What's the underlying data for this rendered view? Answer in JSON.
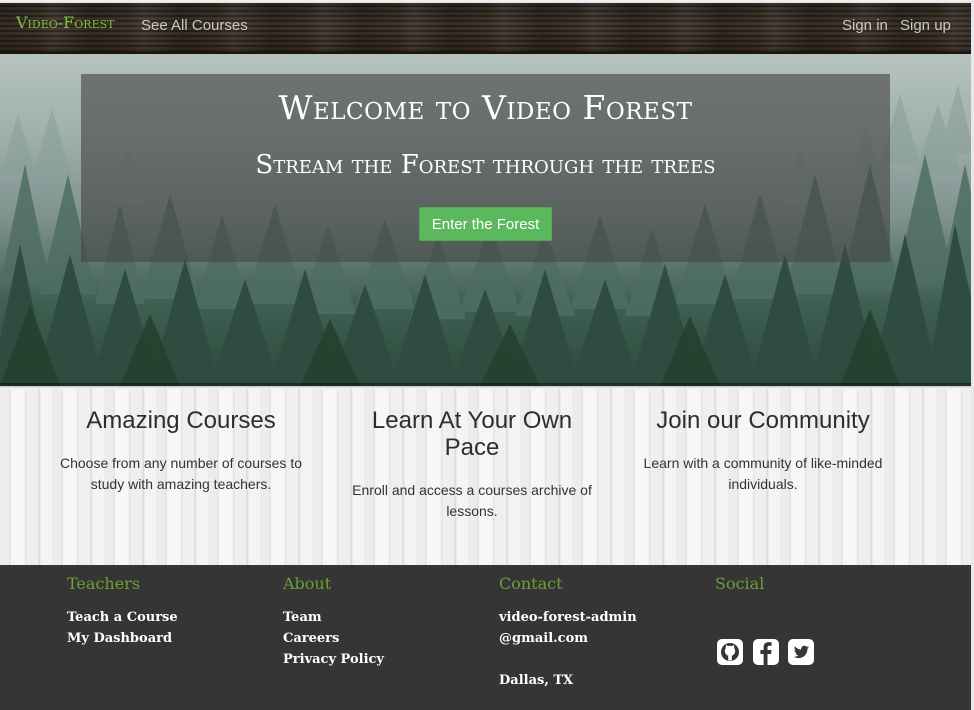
{
  "navbar": {
    "brand": "Video-Forest",
    "all_courses": "See All Courses",
    "sign_in": "Sign in",
    "sign_up": "Sign up"
  },
  "hero": {
    "title": "Welcome to Video Forest",
    "subtitle": "Stream the Forest through the trees",
    "button": "Enter the Forest"
  },
  "features": [
    {
      "title": "Amazing Courses",
      "text": "Choose from any number of courses to study with amazing teachers."
    },
    {
      "title": "Learn At Your Own Pace",
      "text": "Enroll and access a courses archive of lessons."
    },
    {
      "title": "Join our Community",
      "text": "Learn with a community of like-minded individuals."
    }
  ],
  "footer": {
    "teachers": {
      "heading": "Teachers",
      "links": [
        "Teach a Course",
        "My Dashboard"
      ]
    },
    "about": {
      "heading": "About",
      "links": [
        "Team",
        "Careers",
        "Privacy Policy"
      ]
    },
    "contact": {
      "heading": "Contact",
      "email": "video-forest-admin@gmail.com",
      "city": "Dallas, TX"
    },
    "social": {
      "heading": "Social",
      "icons": [
        "github-icon",
        "facebook-icon",
        "twitter-icon"
      ]
    }
  },
  "colors": {
    "brand_green": "#7fbf3f",
    "button_green": "#5cb85c",
    "footer_heading": "#6aa133",
    "footer_bg": "#353535"
  }
}
